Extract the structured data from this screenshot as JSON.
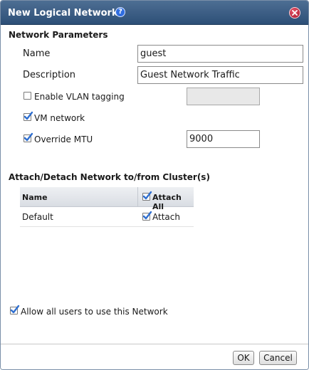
{
  "dialog": {
    "title": "New Logical Network",
    "help_glyph": "?"
  },
  "network_parameters": {
    "heading": "Network Parameters",
    "name_label": "Name",
    "name_value": "guest",
    "description_label": "Description",
    "description_value": "Guest Network Traffic",
    "vlan_label": "Enable VLAN tagging",
    "vlan_checked": false,
    "vlan_value": "",
    "vm_network_label": "VM network",
    "vm_network_checked": true,
    "override_mtu_label": "Override MTU",
    "override_mtu_checked": true,
    "mtu_value": "9000"
  },
  "clusters": {
    "heading": "Attach/Detach Network to/from Cluster(s)",
    "columns": [
      "Name",
      "Attach All"
    ],
    "attach_all_checked": true,
    "rows": [
      {
        "name": "Default",
        "attach_label": "Attach",
        "attached": true
      }
    ]
  },
  "allow_all_users": {
    "label": "Allow all users to use this Network",
    "checked": true
  },
  "footer": {
    "ok_label": "OK",
    "cancel_label": "Cancel"
  },
  "colors": {
    "titlebar": "#3d5f86",
    "checkmark": "#2f6fd0",
    "close": "#c0243a"
  }
}
